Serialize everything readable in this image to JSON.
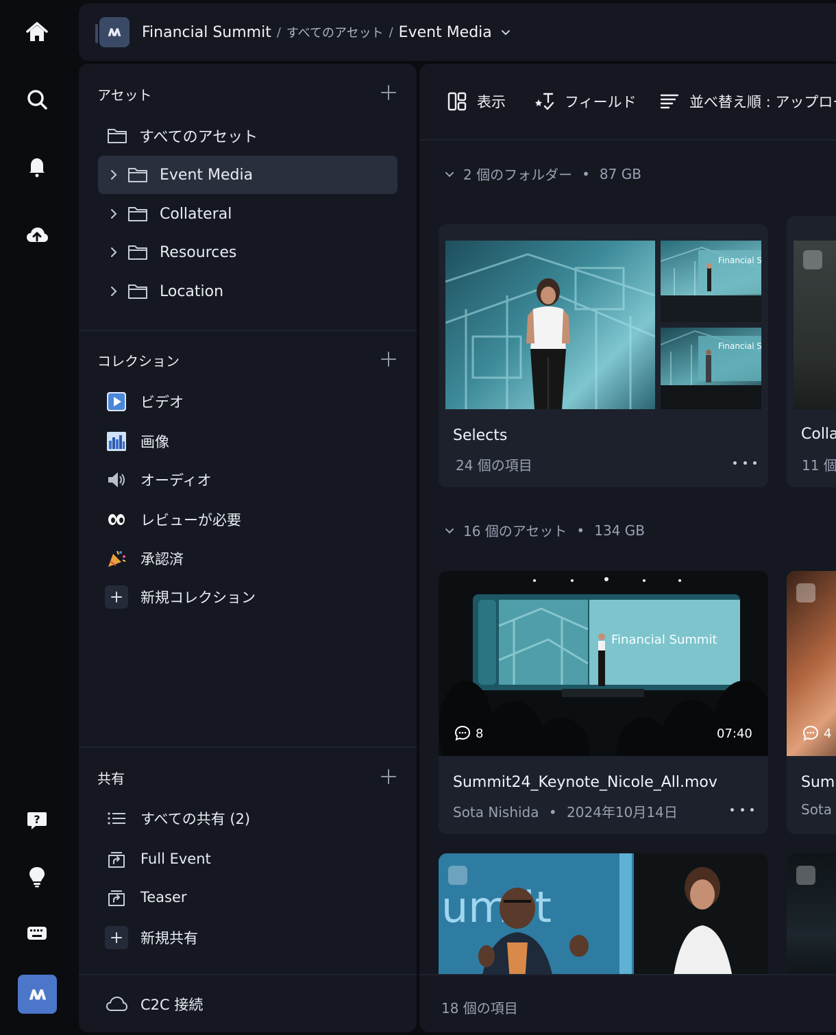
{
  "breadcrumb": {
    "root": "Financial Summit",
    "sep1": "/",
    "middle": "すべてのアセット",
    "sep2": "/",
    "current": "Event Media"
  },
  "sidebar": {
    "assets": {
      "heading": "アセット",
      "all_assets": "すべてのアセット",
      "folders": [
        {
          "label": "Event Media",
          "active": true
        },
        {
          "label": "Collateral"
        },
        {
          "label": "Resources"
        },
        {
          "label": "Location"
        }
      ]
    },
    "collections": {
      "heading": "コレクション",
      "items": [
        {
          "label": "ビデオ",
          "icon": "video-icon"
        },
        {
          "label": "画像",
          "icon": "image-icon"
        },
        {
          "label": "オーディオ",
          "icon": "speaker-icon"
        },
        {
          "label": "レビューが必要",
          "icon": "eyes-icon"
        },
        {
          "label": "承認済",
          "icon": "party-popper-icon"
        }
      ],
      "new_label": "新規コレクション"
    },
    "shared": {
      "heading": "共有",
      "items": [
        {
          "label": "すべての共有 (2)",
          "icon": "list-icon"
        },
        {
          "label": "Full Event",
          "icon": "share-icon"
        },
        {
          "label": "Teaser",
          "icon": "share-icon"
        }
      ],
      "new_label": "新規共有"
    },
    "c2c_label": "C2C 接続"
  },
  "toolbar": {
    "view_label": "表示",
    "fields_label": "フィールド",
    "sort_label": "並べ替え順 : アップロー"
  },
  "folders_group": {
    "label": "2 個のフォルダー",
    "sep": "•",
    "size": "87 GB",
    "cards": [
      {
        "title": "Selects",
        "count": "24 個の項目"
      },
      {
        "title": "Colla",
        "count": "11 個("
      }
    ]
  },
  "assets_group": {
    "label": "16 個のアセット",
    "sep": "•",
    "size": "134 GB",
    "cards": [
      {
        "title": "Summit24_Keynote_Nicole_All.mov",
        "owner": "Sota Nishida",
        "sep": "•",
        "date": "2024年10月14日",
        "comments": "8",
        "duration": "07:40",
        "screen_title": "Financial Summit"
      },
      {
        "title": "Sum",
        "owner": "Sota",
        "comments": "4"
      }
    ],
    "third_thumb_text": "um it"
  },
  "footer_count": "18 個の項目",
  "thumb_text": "Financial S",
  "colors": {
    "accent": "#4b76c9",
    "panel": "#151821",
    "card": "#1d212c",
    "screen": "#7fc6cf"
  }
}
